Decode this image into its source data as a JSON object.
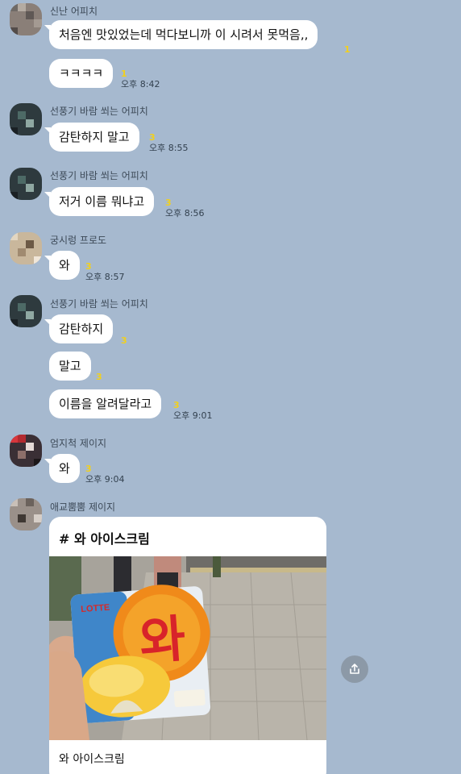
{
  "messages": [
    {
      "sender": "신난 어피치",
      "lines": [
        {
          "text": "처음엔 맛있었는데 먹다보니까 이 시려서 못먹음,,",
          "unread": "1",
          "time": ""
        },
        {
          "text": "ㅋㅋㅋㅋ",
          "unread": "1",
          "time": "오후 8:42"
        }
      ]
    },
    {
      "sender": "선풍기 바람 쐬는 어피치",
      "lines": [
        {
          "text": "감탄하지 말고",
          "unread": "3",
          "time": "오후 8:55"
        }
      ]
    },
    {
      "sender": "선풍기 바람 쐬는 어피치",
      "lines": [
        {
          "text": "저거 이름 뭐냐고",
          "unread": "3",
          "time": "오후 8:56"
        }
      ]
    },
    {
      "sender": "궁시렁 프로도",
      "lines": [
        {
          "text": "와",
          "unread": "3",
          "time": "오후 8:57"
        }
      ]
    },
    {
      "sender": "선풍기 바람 쐬는 어피치",
      "lines": [
        {
          "text": "감탄하지",
          "unread": "3",
          "time": ""
        },
        {
          "text": "말고",
          "unread": "3",
          "time": ""
        },
        {
          "text": "이름을 알려달라고",
          "unread": "3",
          "time": "오후 9:01"
        }
      ]
    },
    {
      "sender": "엄지척 제이지",
      "lines": [
        {
          "text": "와",
          "unread": "3",
          "time": "오후 9:04"
        }
      ]
    },
    {
      "sender": "애교뿜뿜 제이지"
    }
  ],
  "card": {
    "title": "# 와 아이스크림",
    "caption": "와 아이스크림",
    "package_brand": "LOTTE",
    "package_name": "와"
  },
  "icons": {
    "share": "share-icon"
  },
  "colors": {
    "background": "#a6b9cf",
    "bubble": "#ffffff",
    "unread": "#f2d01c"
  }
}
